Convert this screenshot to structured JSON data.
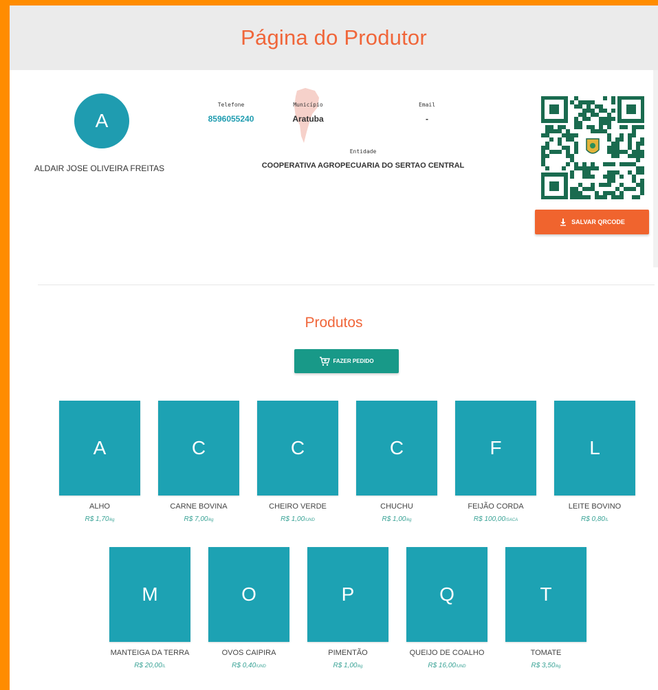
{
  "header": {
    "title": "Página do Produtor"
  },
  "profile": {
    "avatar_letter": "A",
    "name": "ALDAIR JOSE OLIVEIRA FREITAS",
    "phone_label": "Telefone",
    "phone": "8596055240",
    "municipio_label": "Município",
    "municipio": "Aratuba",
    "email_label": "Email",
    "email": "-",
    "entidade_label": "Entidade",
    "entidade": "COOPERATIVA AGROPECUARIA DO SERTAO CENTRAL",
    "save_qr_label": "SALVAR QRCODE"
  },
  "products_section": {
    "title": "Produtos",
    "order_button": "FAZER PEDIDO",
    "items": [
      {
        "letter": "A",
        "name": "ALHO",
        "price": "R$ 1,70",
        "unit": "/kg"
      },
      {
        "letter": "C",
        "name": "CARNE BOVINA",
        "price": "R$ 7,00",
        "unit": "/kg"
      },
      {
        "letter": "C",
        "name": "CHEIRO VERDE",
        "price": "R$ 1,00",
        "unit": "/UND"
      },
      {
        "letter": "C",
        "name": "CHUCHU",
        "price": "R$ 1,00",
        "unit": "/kg"
      },
      {
        "letter": "F",
        "name": "FEIJÃO CORDA",
        "price": "R$ 100,00",
        "unit": "/SACA"
      },
      {
        "letter": "L",
        "name": "LEITE BOVINO",
        "price": "R$ 0,80",
        "unit": "/L"
      },
      {
        "letter": "M",
        "name": "MANTEIGA DA TERRA",
        "price": "R$ 20,00",
        "unit": "/L"
      },
      {
        "letter": "O",
        "name": "OVOS CAIPIRA",
        "price": "R$ 0,40",
        "unit": "/UND"
      },
      {
        "letter": "P",
        "name": "PIMENTÃO",
        "price": "R$ 1,00",
        "unit": "/kg"
      },
      {
        "letter": "Q",
        "name": "QUEIJO DE COALHO",
        "price": "R$ 16,00",
        "unit": "/UND"
      },
      {
        "letter": "T",
        "name": "TOMATE",
        "price": "R$ 3,50",
        "unit": "/kg"
      }
    ]
  },
  "colors": {
    "frame": "#ff8c00",
    "accent": "#f0663a",
    "tile": "#1da2b3",
    "order_button": "#189988",
    "save_button": "#f0642e",
    "qr": "#1a6b4f"
  },
  "icons": {
    "save_qr": "download-icon",
    "order": "cart-plus-icon"
  }
}
